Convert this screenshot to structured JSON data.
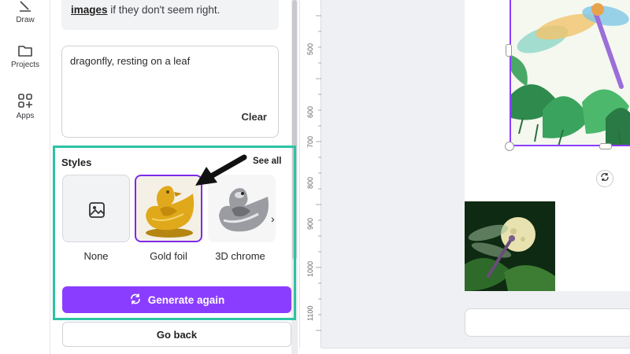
{
  "rail": {
    "items": [
      {
        "label": "Draw",
        "icon": "draw-icon"
      },
      {
        "label": "Projects",
        "icon": "folder-icon"
      },
      {
        "label": "Apps",
        "icon": "apps-icon"
      }
    ]
  },
  "panel": {
    "info_prefix": "images",
    "info_suffix": " if they don't seem right.",
    "prompt_value": "dragonfly, resting on a leaf",
    "clear_label": "Clear",
    "styles_title": "Styles",
    "see_all_label": "See all",
    "styles": [
      {
        "label": "None",
        "icon": "image-icon"
      },
      {
        "label": "Gold foil",
        "selected": true
      },
      {
        "label": "3D chrome"
      }
    ],
    "generate_label": "Generate again",
    "back_label": "Go back"
  },
  "ruler": {
    "ticks": [
      "500",
      "600",
      "700",
      "800",
      "900",
      "1000",
      "1100"
    ]
  },
  "colors": {
    "accent": "#8b3dff",
    "highlight": "#2cc3a5"
  }
}
